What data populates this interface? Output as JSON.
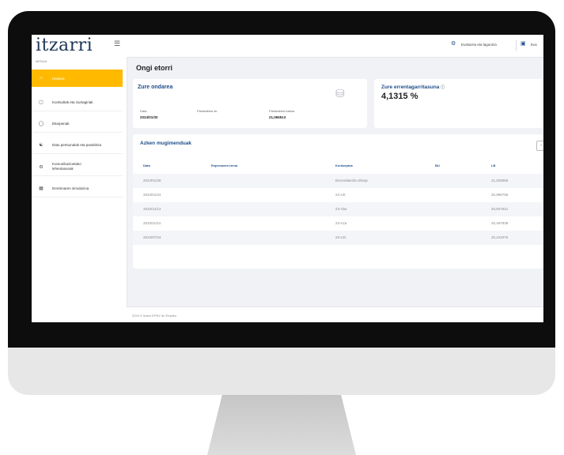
{
  "sidebar": {
    "logo": "itzarri",
    "menu_title": "MENUA",
    "items": [
      {
        "label": "Hasiera",
        "icon": "home-icon"
      },
      {
        "label": "Kontsultak eta ziurtagiriak",
        "icon": "document-icon"
      },
      {
        "label": "Ekarpenak",
        "icon": "coins-icon"
      },
      {
        "label": "Datu pertsonalak eta pasahitza",
        "icon": "user-icon"
      },
      {
        "label": "Komunikazioetako lehentasunak",
        "icon": "settings-icon"
      },
      {
        "label": "Erretiroaren simulazioa",
        "icon": "calculator-icon"
      }
    ]
  },
  "topbar": {
    "help": "Euskarria eta laguntza",
    "lang": "Eus"
  },
  "main": {
    "title": "Ongi etorri",
    "savings": {
      "title": "Zure ondarea",
      "date_label": "Data",
      "date_value": "2024/01/30",
      "shares_label": "Partaidetza zk.",
      "share_value_label": "Partaidetza balioa",
      "share_value": "21,065513"
    },
    "profitability": {
      "title": "Zure errentagarritasuna",
      "value": "4,1315 %"
    },
    "movements": {
      "title": "Azken mugimenduak",
      "columns": [
        "Data",
        "Enpresaren izena",
        "Kontzeptua",
        "BU",
        "LB"
      ],
      "rows": [
        {
          "date": "2024/01/26",
          "company": "",
          "concept": "Borondatezko Ekarp.",
          "bu": "",
          "lb": "21,026059"
        },
        {
          "date": "2024/01/24",
          "company": "",
          "concept": "24-Urt",
          "bu": "",
          "lb": "20,986766"
        },
        {
          "date": "2023/12/14",
          "company": "",
          "concept": "23-Abe",
          "bu": "",
          "lb": "20,837621"
        },
        {
          "date": "2023/11/24",
          "company": "",
          "concept": "23-Aza",
          "bu": "",
          "lb": "20,497838"
        },
        {
          "date": "2023/07/24",
          "company": "",
          "concept": "23-Uzt",
          "bu": "",
          "lb": "20,242075"
        }
      ]
    }
  },
  "footer": "2024 © Itzarri EPSV de Empleo"
}
